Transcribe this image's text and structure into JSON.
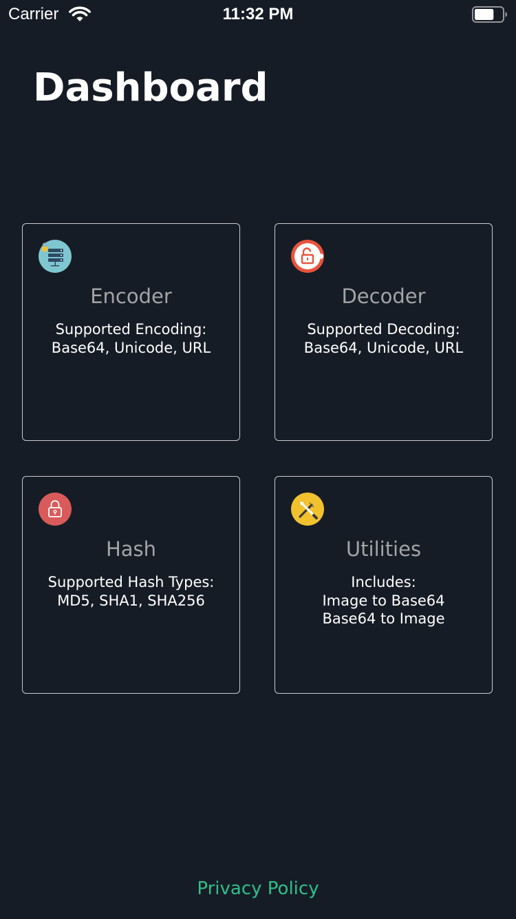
{
  "status_bar": {
    "carrier": "Carrier",
    "time": "11:32 PM",
    "battery_level": 0.7,
    "icons": [
      "wifi-icon",
      "battery-icon"
    ]
  },
  "header": {
    "title": "Dashboard"
  },
  "cards": [
    {
      "id": "encoder",
      "title": "Encoder",
      "icon": "encoder-server-lock-icon",
      "lines": [
        "Supported Encoding:",
        "Base64, Unicode, URL"
      ]
    },
    {
      "id": "decoder",
      "title": "Decoder",
      "icon": "unlock-icon",
      "lines": [
        "Supported Decoding:",
        "Base64, Unicode, URL"
      ]
    },
    {
      "id": "hash",
      "title": "Hash",
      "icon": "lock-icon",
      "lines": [
        "Supported Hash Types:",
        "MD5, SHA1, SHA256"
      ]
    },
    {
      "id": "utilities",
      "title": "Utilities",
      "icon": "tools-icon",
      "lines": [
        "Includes:",
        "Image to Base64",
        "Base64 to Image"
      ]
    }
  ],
  "footer": {
    "privacy_label": "Privacy Policy"
  },
  "colors": {
    "background": "#161c25",
    "card_border": "#c9ccd1",
    "card_title": "#a2a4a7",
    "link": "#2ec08a",
    "encoder_icon": "#7ec7d1",
    "decoder_icon": "#e8543d",
    "hash_icon": "#d95a5a",
    "utilities_icon": "#f2c12e"
  }
}
